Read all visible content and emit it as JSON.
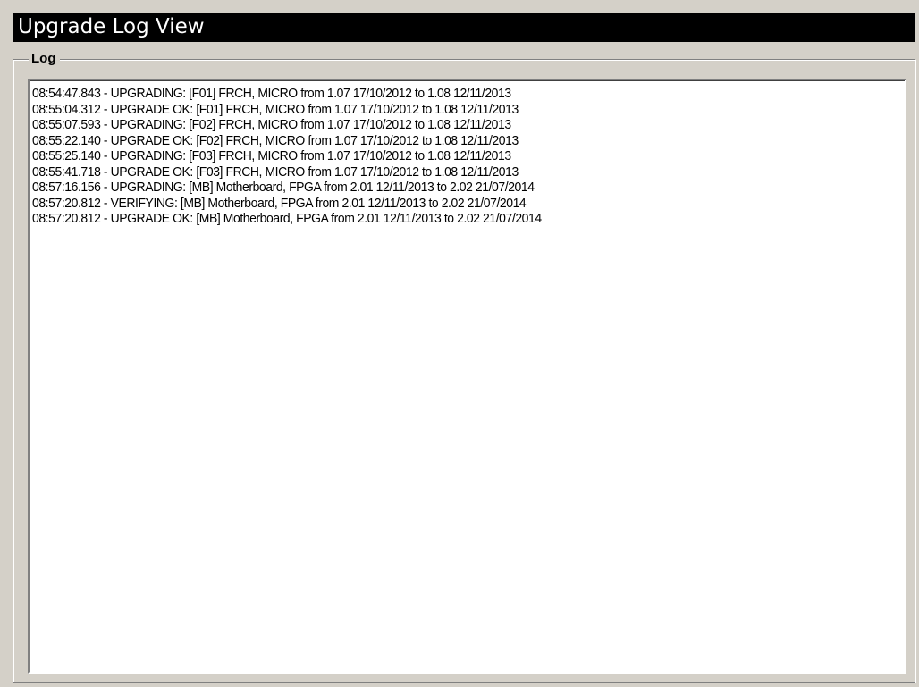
{
  "window": {
    "title": "Upgrade Log View"
  },
  "log_group": {
    "label": "Log",
    "lines": [
      "08:54:47.843 - UPGRADING: [F01] FRCH, MICRO from 1.07 17/10/2012 to 1.08 12/11/2013",
      "08:55:04.312 - UPGRADE OK: [F01] FRCH, MICRO from 1.07 17/10/2012 to 1.08 12/11/2013",
      "08:55:07.593 - UPGRADING: [F02] FRCH, MICRO from 1.07 17/10/2012 to 1.08 12/11/2013",
      "08:55:22.140 - UPGRADE OK: [F02] FRCH, MICRO from 1.07 17/10/2012 to 1.08 12/11/2013",
      "08:55:25.140 - UPGRADING: [F03] FRCH, MICRO from 1.07 17/10/2012 to 1.08 12/11/2013",
      "08:55:41.718 - UPGRADE OK: [F03] FRCH, MICRO from 1.07 17/10/2012 to 1.08 12/11/2013",
      "08:57:16.156 - UPGRADING: [MB] Motherboard, FPGA from 2.01 12/11/2013 to 2.02 21/07/2014",
      "08:57:20.812 - VERIFYING: [MB] Motherboard, FPGA from 2.01 12/11/2013 to 2.02 21/07/2014",
      "08:57:20.812 - UPGRADE OK: [MB] Motherboard, FPGA from 2.01 12/11/2013 to 2.02 21/07/2014"
    ]
  },
  "colors": {
    "window_bg": "#d4d0c8",
    "title_bg": "#000000",
    "title_fg": "#ffffff",
    "log_bg": "#ffffff"
  }
}
